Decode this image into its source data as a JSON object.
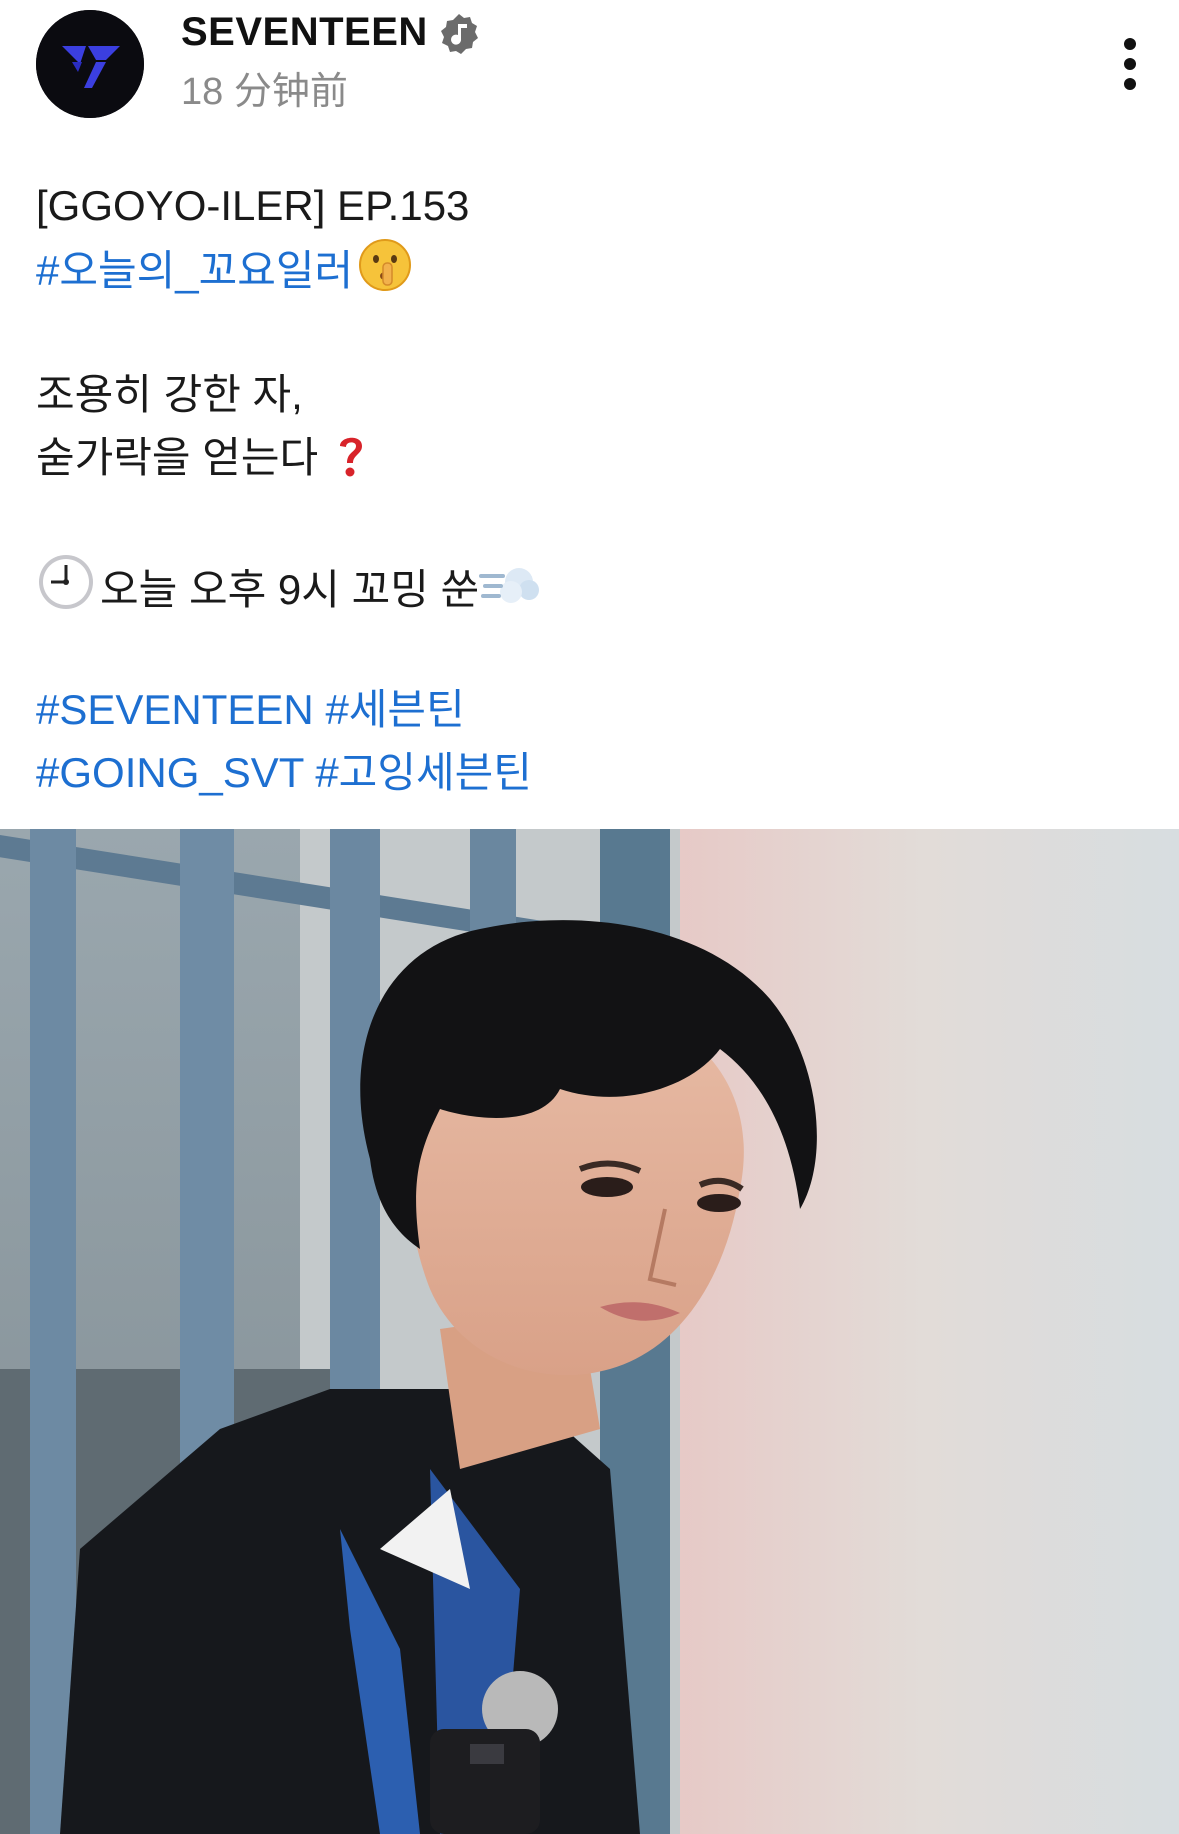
{
  "post": {
    "author": {
      "name": "SEVENTEEN",
      "avatar_icon": "seventeen-logo",
      "badge_icon": "verified-music-badge"
    },
    "time": "18 分钟前",
    "menu_icon": "more-vertical-icon",
    "content": {
      "title_line": "[GGOYO-ILER] EP.153",
      "hashtag_1": "#오늘의_꼬요일러",
      "emoji_1": "shushing-face",
      "line_2": "조용히 강한 자,",
      "line_3": "숟가락을 얻는다",
      "emoji_3": "red-question-mark",
      "emoji_4": "clock-icon",
      "line_4": "오늘 오후 9시 꼬밍 쑨",
      "emoji_4b": "dash-symbol",
      "hashtags_row1": [
        "#SEVENTEEN",
        "#세븐틴"
      ],
      "hashtags_row2": [
        "#GOING_SVT",
        "#고잉세븐틴"
      ]
    },
    "image": {
      "description_icon": "photo"
    },
    "colors": {
      "hashtag": "#1d6fd1",
      "time": "#8a8a8a",
      "avatar_bg": "#0b0b10",
      "logo_blue": "#3b3fe0"
    }
  }
}
